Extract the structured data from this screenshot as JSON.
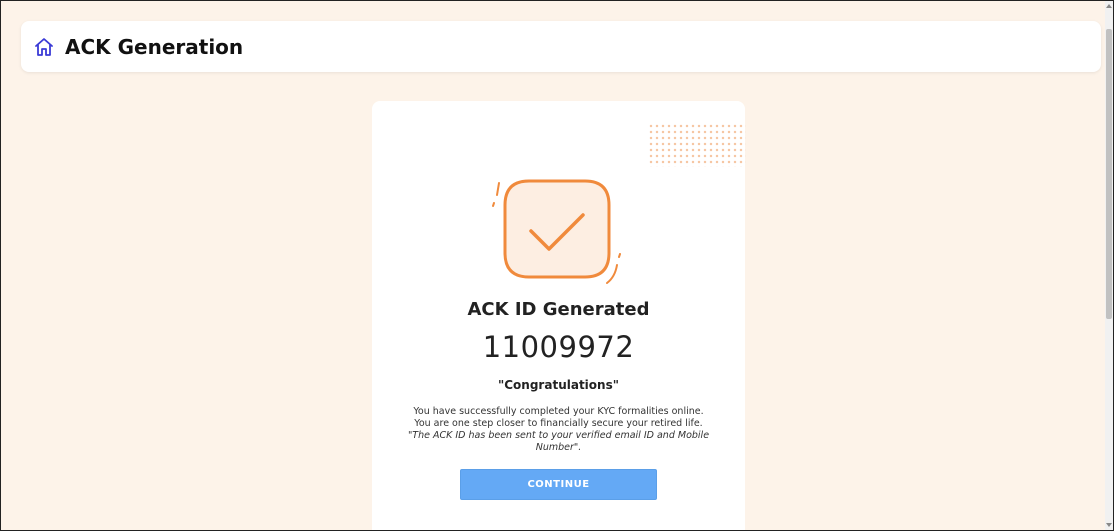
{
  "header": {
    "title": "ACK Generation",
    "icon": "home-icon"
  },
  "card": {
    "icon": "checkmark-icon",
    "heading": "ACK ID Generated",
    "ack_id": "11009972",
    "congrats": "\"Congratulations\"",
    "message_lines": [
      "You have successfully completed your KYC formalities online.",
      "You are one step closer to financially secure your retired life."
    ],
    "note": "\"The ACK ID has been sent to your verified email ID and Mobile Number\".",
    "continue_label": "CONTINUE"
  },
  "colors": {
    "background": "#fdf3e9",
    "accent_orange": "#f08a3c",
    "button_blue": "#64a9f5",
    "home_icon": "#3b3bd6"
  }
}
